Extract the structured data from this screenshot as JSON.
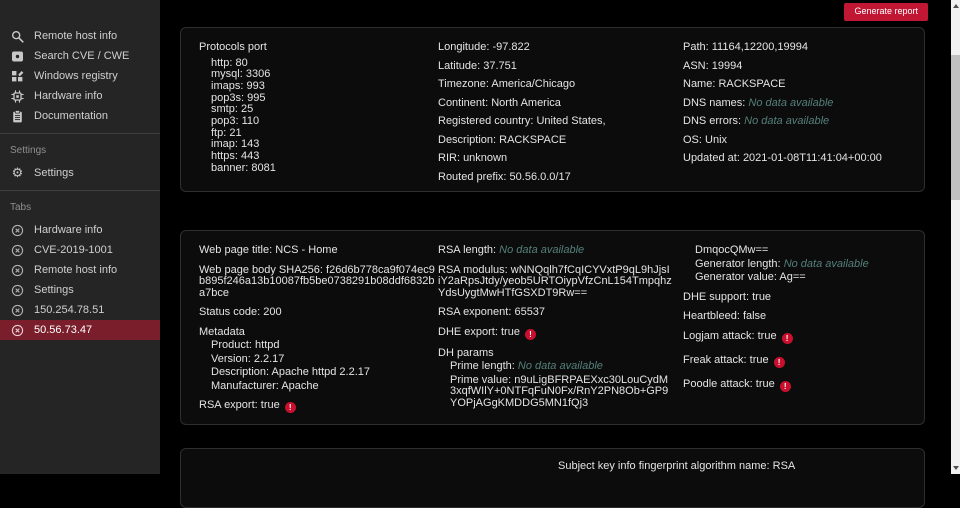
{
  "header": {
    "generate_report_label": "Generate report"
  },
  "colors": {
    "accent_red": "#c11734",
    "alert_red": "#c8102e",
    "active_tab_bg": "#7a1e2c",
    "muted_value": "#55807a",
    "sidebar_bg": "#252526"
  },
  "sidebar": {
    "nav_items": [
      {
        "label": "Remote host info",
        "icon": "search"
      },
      {
        "label": "Search CVE / CWE",
        "icon": "cve-square"
      },
      {
        "label": "Windows registry",
        "icon": "windows-registry"
      },
      {
        "label": "Hardware info",
        "icon": "hardware-chip"
      },
      {
        "label": "Documentation",
        "icon": "clipboard"
      }
    ],
    "settings": {
      "section_label": "Settings",
      "item": {
        "label": "Settings",
        "icon": "gear"
      }
    },
    "tabs_section_label": "Tabs",
    "tabs": [
      {
        "label": "Hardware info",
        "active": false
      },
      {
        "label": "CVE-2019-1001",
        "active": false
      },
      {
        "label": "Remote host info",
        "active": false
      },
      {
        "label": "Settings",
        "active": false
      },
      {
        "label": "150.254.78.51",
        "active": false
      },
      {
        "label": "50.56.73.47",
        "active": true
      }
    ]
  },
  "host_panel": {
    "protocols": {
      "title": "Protocols port",
      "ports": [
        "http: 80",
        "mysql: 3306",
        "imaps: 993",
        "pop3s: 995",
        "smtp: 25",
        "pop3: 110",
        "ftp: 21",
        "imap: 143",
        "https: 443",
        "banner: 8081"
      ]
    },
    "geo": [
      {
        "label": "Longitude:",
        "value": "-97.822"
      },
      {
        "label": "Latitude:",
        "value": "37.751"
      },
      {
        "label": "Timezone:",
        "value": "America/Chicago"
      },
      {
        "label": "Continent:",
        "value": "North America"
      },
      {
        "label": "Registered country:",
        "value": "United States,"
      },
      {
        "label": "Description:",
        "value": "RACKSPACE"
      },
      {
        "label": "RIR:",
        "value": "unknown"
      },
      {
        "label": "Routed prefix:",
        "value": "50.56.0.0/17"
      }
    ],
    "network": [
      {
        "label": "Path:",
        "value": "11164,12200,19994"
      },
      {
        "label": "ASN:",
        "value": "19994"
      },
      {
        "label": "Name:",
        "value": "RACKSPACE"
      },
      {
        "label": "DNS names:",
        "value": "No data available",
        "muted": true
      },
      {
        "label": "DNS errors:",
        "value": "No data available",
        "muted": true
      },
      {
        "label": "OS:",
        "value": "Unix"
      },
      {
        "label": "Updated at:",
        "value": "2021-01-08T11:41:04+00:00"
      }
    ]
  },
  "web_panel": {
    "col1": [
      {
        "label": "Web page title:",
        "value": "NCS - Home"
      },
      {
        "label": "Web page body SHA256:",
        "value": "f26d6b778ca9f074ec9b895f246a13b10087fb5be0738291b08ddf6832ba7bce",
        "break": true
      },
      {
        "label": "Status code:",
        "value": "200"
      },
      {
        "label": "Metadata",
        "value": "",
        "tight": true
      },
      {
        "label": "Product:",
        "value": "httpd",
        "indent": true,
        "tight": true
      },
      {
        "label": "Version:",
        "value": "2.2.17",
        "indent": true,
        "tight": true
      },
      {
        "label": "Description:",
        "value": "Apache httpd 2.2.17",
        "indent": true,
        "tight": true
      },
      {
        "label": "Manufacturer:",
        "value": "Apache",
        "indent": true
      },
      {
        "label": "RSA export:",
        "value": "true",
        "alert": true
      }
    ],
    "col2": [
      {
        "label": "RSA length:",
        "value": "No data available",
        "muted": true
      },
      {
        "label": "RSA modulus:",
        "value": "wNNQqlh7fCqICYVxtP9qL9hJjsIiY2aRpsJtdy/yeob5URTOiypVfzCnL154TmpqhzYdsUygtMwHTfGSXDT9Rw==",
        "break": true
      },
      {
        "label": "RSA exponent:",
        "value": "65537"
      },
      {
        "label": "DHE export:",
        "value": "true",
        "alert": true
      },
      {
        "label": "DH params",
        "value": "",
        "tight": true
      },
      {
        "label": "Prime length:",
        "value": "No data available",
        "muted": true,
        "indent": true,
        "tight": true
      },
      {
        "label": "Prime value:",
        "value": "n9uLigBFRPAEXxc30LouCydM3xqfWIlY+0NTFqFuN0Fx/RnY2PN8Ob+GP9YOPjAGgKMDDG5MN1fQj3",
        "indent": true,
        "break": true
      }
    ],
    "col3": [
      {
        "label": "",
        "value": "DmqocQMw==",
        "indent": true,
        "tight": true
      },
      {
        "label": "Generator length:",
        "value": "No data available",
        "muted": true,
        "indent": true,
        "tight": true
      },
      {
        "label": "Generator value:",
        "value": "Ag==",
        "indent": true
      },
      {
        "label": "DHE support:",
        "value": "true"
      },
      {
        "label": "Heartbleed:",
        "value": "false"
      },
      {
        "label": "Logjam attack:",
        "value": "true",
        "alert": true,
        "roomy": true
      },
      {
        "label": "Freak attack:",
        "value": "true",
        "alert": true,
        "roomy": true
      },
      {
        "label": "Poodle attack:",
        "value": "true",
        "alert": true
      }
    ]
  },
  "cert_panel": {
    "row": {
      "label": "Subject key info fingerprint algorithm name:",
      "value": "RSA"
    }
  }
}
